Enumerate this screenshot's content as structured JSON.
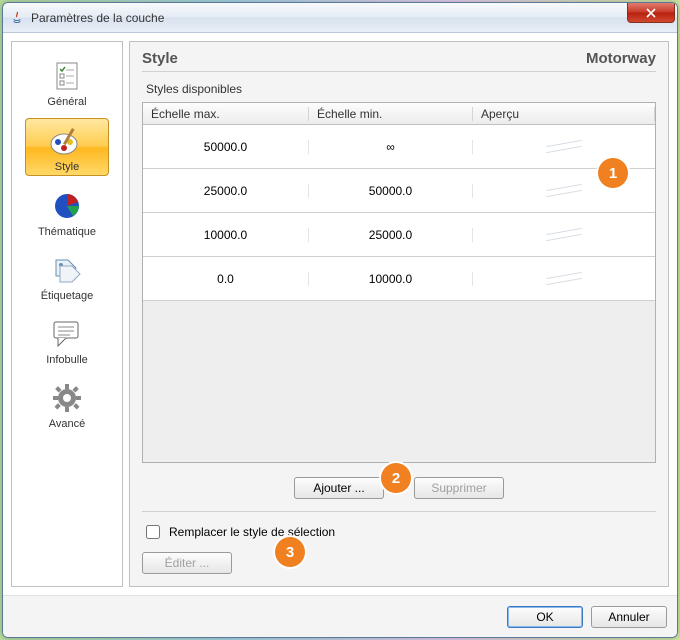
{
  "window": {
    "title": "Paramètres de la couche"
  },
  "sidebar": {
    "items": [
      {
        "label": "Général"
      },
      {
        "label": "Style"
      },
      {
        "label": "Thématique"
      },
      {
        "label": "Étiquetage"
      },
      {
        "label": "Infobulle"
      },
      {
        "label": "Avancé"
      }
    ]
  },
  "main": {
    "section": "Style",
    "layer_name": "Motorway",
    "styles_label": "Styles disponibles",
    "columns": {
      "max": "Échelle max.",
      "min": "Échelle min.",
      "preview": "Aperçu"
    },
    "rows": [
      {
        "max": "50000.0",
        "min": "∞"
      },
      {
        "max": "25000.0",
        "min": "50000.0"
      },
      {
        "max": "10000.0",
        "min": "25000.0"
      },
      {
        "max": "0.0",
        "min": "10000.0"
      }
    ],
    "add_label": "Ajouter ...",
    "remove_label": "Supprimer",
    "replace_checkbox_label": "Remplacer le style de sélection",
    "edit_label": "Éditer ..."
  },
  "footer": {
    "ok": "OK",
    "cancel": "Annuler"
  },
  "markers": {
    "m1": "1",
    "m2": "2",
    "m3": "3"
  }
}
